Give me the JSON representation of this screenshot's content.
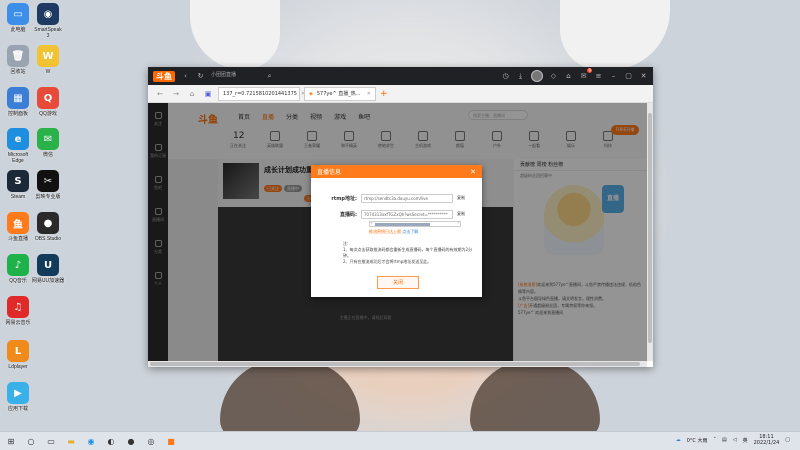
{
  "desktop": {
    "icons": [
      {
        "label": "此电脑",
        "color": "#3c8ee8",
        "glyph": "▭"
      },
      {
        "label": "SmartSpeak\n3",
        "color": "#1e3a63",
        "glyph": "◉"
      },
      {
        "label": "回收站",
        "color": "#9aa4b0",
        "glyph": "🗑"
      },
      {
        "label": "W",
        "color": "#f1c232",
        "glyph": "W"
      },
      {
        "label": "控制面板",
        "color": "#3a7fd5",
        "glyph": "▦"
      },
      {
        "label": "QQ游戏",
        "color": "#e84a3a",
        "glyph": "Q"
      },
      {
        "label": "Microsoft\nEdge",
        "color": "#1d8ee0",
        "glyph": "e"
      },
      {
        "label": "微信",
        "color": "#2ab24a",
        "glyph": "✉"
      },
      {
        "label": "Steam",
        "color": "#1b2838",
        "glyph": "S"
      },
      {
        "label": "剪映专业版",
        "color": "#111111",
        "glyph": "✂"
      },
      {
        "label": "斗鱼直播",
        "color": "#ff7a1a",
        "glyph": "鱼"
      },
      {
        "label": "OBS Studio",
        "color": "#2a2a2a",
        "glyph": "●"
      },
      {
        "label": "QQ音乐",
        "color": "#20b24a",
        "glyph": "♪"
      },
      {
        "label": "网易UU加速器",
        "color": "#123a5a",
        "glyph": "U"
      },
      {
        "label": "网易云音乐",
        "color": "#e02a2a",
        "glyph": "♫"
      },
      {
        "label": "Ldplayer",
        "color": "#f08a1a",
        "glyph": "L"
      },
      {
        "label": "应用下载",
        "color": "#3ab0e8",
        "glyph": "▶"
      }
    ]
  },
  "browser": {
    "app_logo": "斗鱼",
    "search_hint": "小团团直播",
    "address": "137_r=0.7215810201441375",
    "active_tab": "577ye^ 直播_热...",
    "notification_count": "9"
  },
  "sidebar": {
    "items": [
      "关注",
      "我的订阅",
      "鱼吧",
      "直播间",
      "分类",
      "个人"
    ]
  },
  "site": {
    "logo": "斗鱼",
    "nav": [
      "首页",
      "直播",
      "分类",
      "视频",
      "游戏",
      "鱼吧"
    ],
    "categories": [
      {
        "icon": "12",
        "label": "正在关注"
      },
      {
        "label": "英雄联盟"
      },
      {
        "label": "王者荣耀"
      },
      {
        "label": "和平精英"
      },
      {
        "label": "绝地求生"
      },
      {
        "label": "主机游戏"
      },
      {
        "label": "颜值"
      },
      {
        "label": "户外"
      },
      {
        "label": "一起看"
      },
      {
        "label": "娱乐"
      },
      {
        "label": "科技"
      }
    ],
    "search_placeholder": "搜索主播、直播间",
    "right_button": "FORE开播"
  },
  "stream": {
    "title": "成长计划成功重启",
    "pills": [
      "已关注",
      "直播中",
      "分享"
    ],
    "player_hint": "主播正在直播中，请稍后观看"
  },
  "right_panel": {
    "header": "贡献榜  周榜  粉丝榜",
    "subtext": "超级粉丝团招募中",
    "mascot_badge": "直播",
    "chat": [
      {
        "tag": "[系统消息]",
        "text": "欢迎来到577ye^直播间，斗鱼严禁传播违法违规、低俗色情等内容。"
      },
      {
        "tag": "",
        "text": "斗鱼平台倡导绿色直播，请文明发言，理性消费。"
      },
      {
        "tag": "[广告]",
        "text": "开通超级粉丝团，专属特权等你来领。"
      },
      {
        "tag": "",
        "text": "577ye^ 欢迎来到直播间"
      }
    ]
  },
  "modal": {
    "title": "直播信息",
    "close_glyph": "✕",
    "rtmp_label": "rtmp地址:",
    "rtmp_value": "rtmp://sendtc3a.douyu.com/live",
    "key_label": "直播码:",
    "key_value": "7074313xxfTGZxQh?wsSecret=**********",
    "copy_label": "复制",
    "warning": "推流密钥已达上限",
    "warning_link": "点击了解",
    "notes": [
      "注:",
      "1、每次点击获取推流码都会重新生成直播码，每个直播码的有效期为2分钟。",
      "2、只有在推流成功后才会将rtmp地址发送至此。"
    ],
    "ok_button": "关闭"
  },
  "taskbar": {
    "weather": "0°C 大雨",
    "time": "18:11",
    "date": "2022/1/24"
  }
}
